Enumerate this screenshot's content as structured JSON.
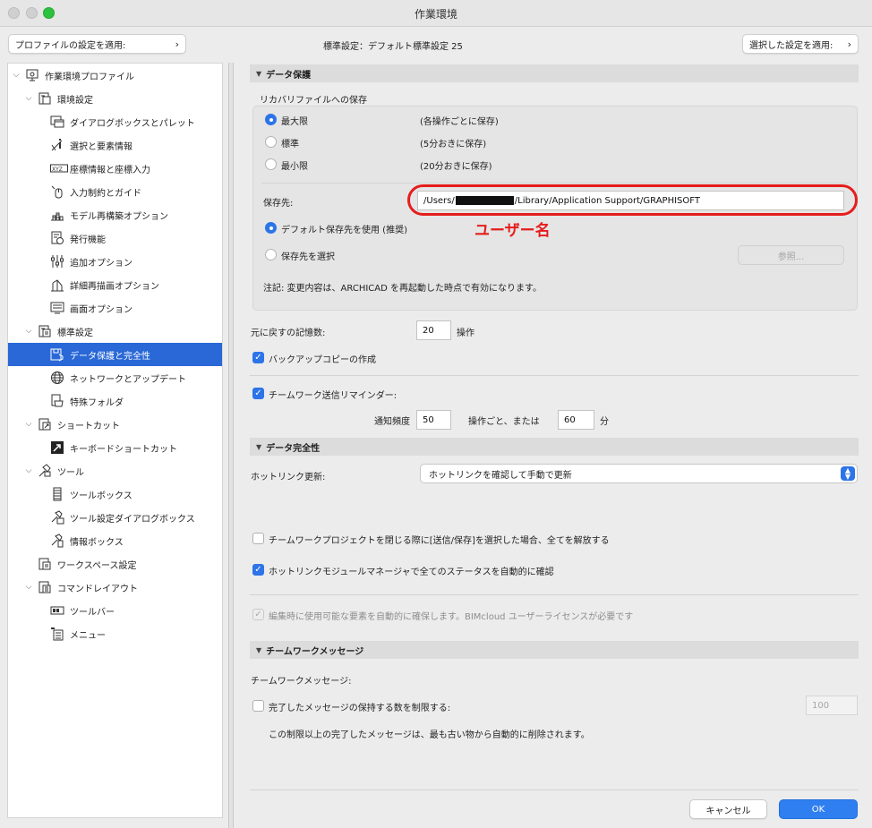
{
  "window": {
    "title": "作業環境"
  },
  "toolbar": {
    "apply_profile": "プロファイルの設定を適用:",
    "standard_info": "標準設定：デフォルト標準設定 25",
    "apply_selected": "選択した設定を適用:"
  },
  "sidebar": {
    "items": [
      {
        "label": "作業環境プロファイル",
        "icon": "profile-icon"
      },
      {
        "label": "環境設定",
        "icon": "environment-settings-icon"
      },
      {
        "label": "ダイアログボックスとパレット",
        "icon": "dialog-palette-icon"
      },
      {
        "label": "選択と要素情報",
        "icon": "selection-info-icon"
      },
      {
        "label": "座標情報と座標入力",
        "icon": "xyz-coordinate-icon"
      },
      {
        "label": "入力制約とガイド",
        "icon": "mouse-constraint-icon"
      },
      {
        "label": "モデル再構築オプション",
        "icon": "model-rebuild-icon"
      },
      {
        "label": "発行機能",
        "icon": "publish-icon"
      },
      {
        "label": "追加オプション",
        "icon": "sliders-icon"
      },
      {
        "label": "詳細再描画オプション",
        "icon": "redraw-icon"
      },
      {
        "label": "画面オプション",
        "icon": "screen-options-icon"
      },
      {
        "label": "標準設定",
        "icon": "standard-settings-icon"
      },
      {
        "label": "データ保護と完全性",
        "icon": "data-protection-icon"
      },
      {
        "label": "ネットワークとアップデート",
        "icon": "globe-icon"
      },
      {
        "label": "特殊フォルダ",
        "icon": "special-folder-icon"
      },
      {
        "label": "ショートカット",
        "icon": "shortcut-icon"
      },
      {
        "label": "キーボードショートカット",
        "icon": "keyboard-shortcut-icon"
      },
      {
        "label": "ツール",
        "icon": "tools-icon"
      },
      {
        "label": "ツールボックス",
        "icon": "toolbox-icon"
      },
      {
        "label": "ツール設定ダイアログボックス",
        "icon": "tool-settings-icon"
      },
      {
        "label": "情報ボックス",
        "icon": "info-box-icon"
      },
      {
        "label": "ワークスペース設定",
        "icon": "workspace-icon"
      },
      {
        "label": "コマンドレイアウト",
        "icon": "command-layout-icon"
      },
      {
        "label": "ツールバー",
        "icon": "toolbar-icon"
      },
      {
        "label": "メニュー",
        "icon": "menu-icon"
      }
    ]
  },
  "data_protection": {
    "header": "データ保護",
    "recovery_label": "リカバリファイルへの保存",
    "options": [
      {
        "label": "最大限",
        "desc": "(各操作ごとに保存)"
      },
      {
        "label": "標準",
        "desc": "(5分おきに保存)"
      },
      {
        "label": "最小限",
        "desc": "(20分おきに保存)"
      }
    ],
    "save_location_label": "保存先:",
    "path_prefix": "/Users/",
    "path_suffix": "/Library/Application Support/GRAPHISOFT",
    "annotation": "ユーザー名",
    "use_default": "デフォルト保存先を使用 (推奨)",
    "choose_location": "保存先を選択",
    "browse": "参照...",
    "note": "注記: 変更内容は、ARCHICAD を再起動した時点で有効になります。",
    "undo_label": "元に戻すの記憶数:",
    "undo_value": "20",
    "undo_unit": "操作",
    "backup_label": "バックアップコピーの作成",
    "reminder_label": "チームワーク送信リマインダー:",
    "freq_label": "通知頻度",
    "freq_value": "50",
    "freq_mid": "操作ごと、または",
    "minutes_value": "60",
    "minutes_unit": "分"
  },
  "data_integrity": {
    "header": "データ完全性",
    "hotlink_label": "ホットリンク更新:",
    "hotlink_value": "ホットリンクを確認して手動で更新",
    "release_label": "チームワークプロジェクトを閉じる際に[送信/保存]を選択した場合、全てを解放する",
    "check_status_label": "ホットリンクモジュールマネージャで全てのステータスを自動的に確認",
    "auto_reserve_label": "編集時に使用可能な要素を自動的に確保します。BIMcloud ユーザーライセンスが必要です"
  },
  "teamwork": {
    "header": "チームワークメッセージ",
    "label": "チームワークメッセージ:",
    "limit_label": "完了したメッセージの保持する数を制限する:",
    "limit_value": "100",
    "limit_note": "この制限以上の完了したメッセージは、最も古い物から自動的に削除されます。"
  },
  "footer": {
    "cancel": "キャンセル",
    "ok": "OK"
  },
  "colors": {
    "accent": "#2d74e8",
    "selection": "#2968d6",
    "annotation": "#e51d1d"
  }
}
